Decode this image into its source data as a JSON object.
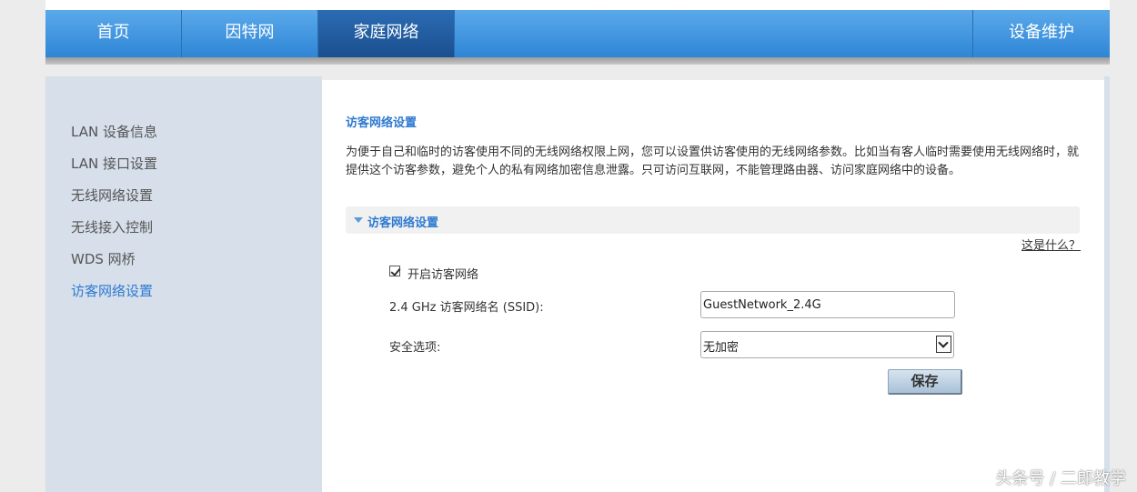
{
  "nav": {
    "items": [
      "首页",
      "因特网",
      "家庭网络"
    ],
    "active_index": 2,
    "right_item": "设备维护"
  },
  "sidebar": {
    "items": [
      "LAN 设备信息",
      "LAN 接口设置",
      "无线网络设置",
      "无线接入控制",
      "WDS 网桥",
      "访客网络设置"
    ],
    "active_index": 5
  },
  "content": {
    "title": "访客网络设置",
    "description": "为便于自己和临时的访客使用不同的无线网络权限上网，您可以设置供访客使用的无线网络参数。比如当有客人临时需要使用无线网络时，就提供这个访客参数，避免个人的私有网络加密信息泄露。只可访问互联网，不能管理路由器、访问家庭网络中的设备。",
    "section_label": "访客网络设置",
    "help_link": "这是什么？",
    "enable_label": "开启访客网络",
    "enable_checked": true,
    "ssid_label": "2.4 GHz 访客网络名 (SSID):",
    "ssid_value": "GuestNetwork_2.4G",
    "security_label": "安全选项:",
    "security_value": "无加密",
    "save_label": "保存"
  },
  "watermark": "头条号 / 二郎教学",
  "colors": {
    "nav_blue": "#3a8fdc",
    "nav_active": "#23599f",
    "link_blue": "#2e7ad1",
    "sidebar_bg": "#d6dfea"
  }
}
